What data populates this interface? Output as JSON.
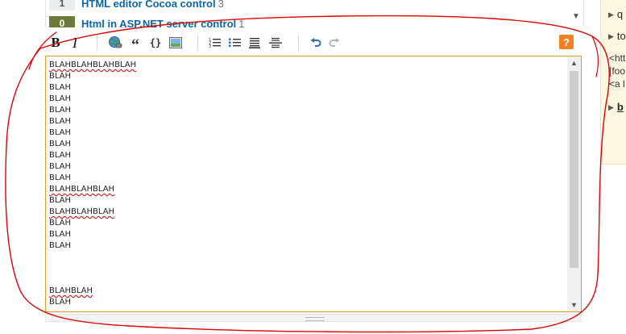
{
  "related": {
    "items": [
      {
        "votes": "1",
        "title": "HTML editor Cocoa control",
        "count": "3",
        "accepted": false
      },
      {
        "votes": "0",
        "title": "Html in ASP.NET server control",
        "count": "1",
        "accepted": true
      }
    ]
  },
  "toolbar": {
    "help_label": "?"
  },
  "editor": {
    "lines": [
      "BLAHBLAHBLAHBLAH",
      "BLAH",
      "BLAH",
      "BLAH",
      "BLAH",
      "BLAH",
      "BLAH",
      "BLAH",
      "BLAH",
      "BLAH",
      "BLAH",
      "BLAHBLAHBLAH",
      "BLAH",
      "BLAHBLAHBLAH",
      "BLAH",
      "BLAH",
      "BLAH",
      "",
      "",
      "",
      "BLAHBLAH",
      "BLAH"
    ]
  },
  "sidebar": {
    "items": [
      {
        "label": "q"
      },
      {
        "label": "to"
      }
    ],
    "code_lines": [
      "<htt",
      "[foo",
      "<a l"
    ],
    "bold_item": "b"
  },
  "colors": {
    "accent": "#f48024",
    "annotation": "#e00000",
    "editor_border": "#e39a2c",
    "sidebar_bg": "#fdf7e2"
  }
}
